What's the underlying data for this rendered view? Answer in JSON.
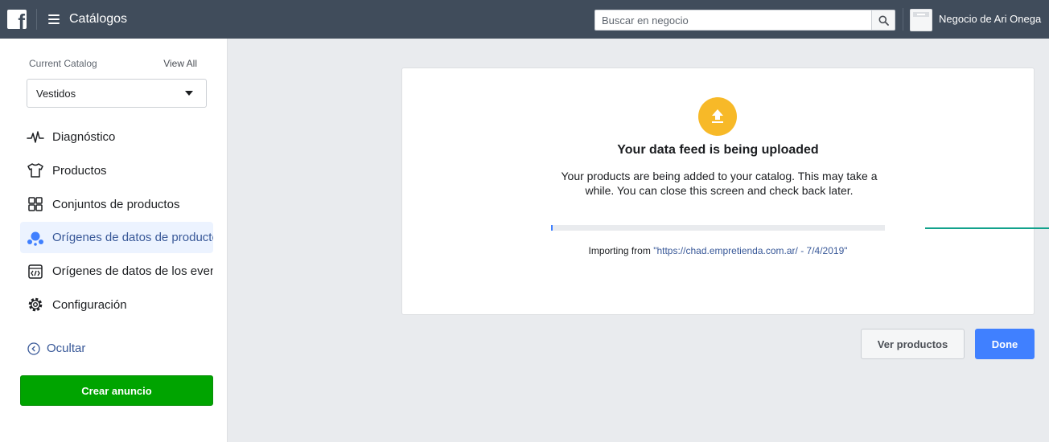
{
  "topbar": {
    "logo_letter": "f",
    "app_title": "Catálogos",
    "search": {
      "placeholder": "Buscar en negocio",
      "value": ""
    },
    "business_name": "Negocio de Ari Onega"
  },
  "sidebar": {
    "current_catalog_label": "Current Catalog",
    "view_all_label": "View All",
    "catalog_selected": "Vestidos",
    "items": [
      {
        "label": "Diagnóstico",
        "icon": "pulse-icon",
        "active": false
      },
      {
        "label": "Productos",
        "icon": "shirt-icon",
        "active": false
      },
      {
        "label": "Conjuntos de productos",
        "icon": "grid-icon",
        "active": false
      },
      {
        "label": "Orígenes de datos de productos",
        "icon": "data-sources-icon",
        "active": true
      },
      {
        "label": "Orígenes de datos de los eventos",
        "icon": "code-window-icon",
        "active": false
      },
      {
        "label": "Configuración",
        "icon": "gear-icon",
        "active": false
      }
    ],
    "hide_label": "Ocultar",
    "create_ad_label": "Crear anuncio"
  },
  "upload_card": {
    "title": "Your data feed is being uploaded",
    "description": "Your products are being added to your catalog. This may take a while. You can close this screen and check back later.",
    "progress": 0.004,
    "import_prefix": "Importing from ",
    "import_source": "\"https://chad.empretienda.com.ar/ - 7/4/2019\""
  },
  "actions": {
    "view_products_label": "Ver productos",
    "done_label": "Done"
  },
  "colors": {
    "topbar": "#404c5b",
    "accent_blue": "#4080ff",
    "link_blue": "#385898",
    "green_button": "#00a400",
    "upload_icon": "#f7b928",
    "active_bg": "#ecf3ff"
  }
}
